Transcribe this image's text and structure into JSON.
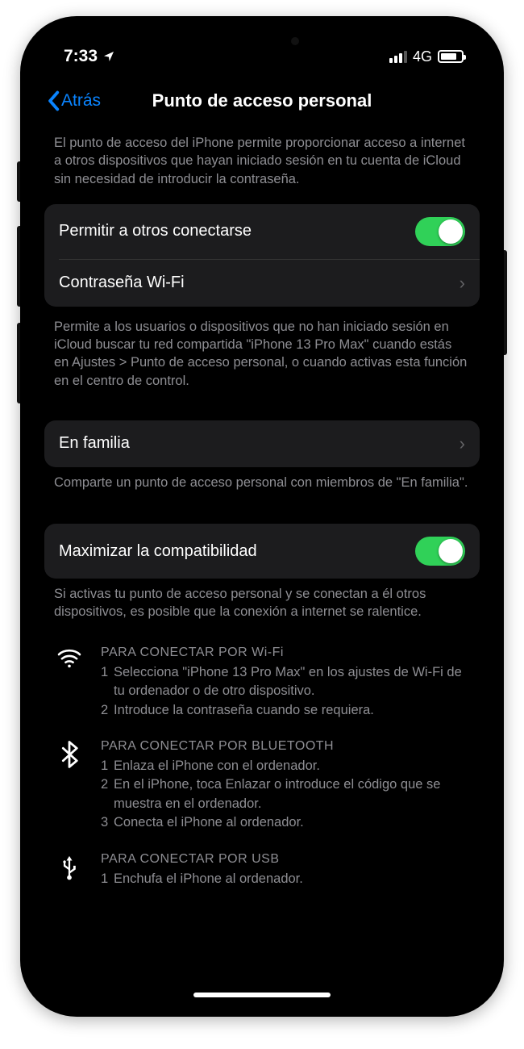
{
  "status": {
    "time": "7:33",
    "network_label": "4G"
  },
  "nav": {
    "back": "Atrás",
    "title": "Punto de acceso personal"
  },
  "desc1": "El punto de acceso del iPhone permite proporcionar acceso a internet a otros dispositivos que hayan iniciado sesión en tu cuenta de iCloud sin necesidad de introducir la contraseña.",
  "rows": {
    "allow": "Permitir a otros conectarse",
    "wifi_pwd": "Contraseña Wi-Fi",
    "family": "En familia",
    "maximize": "Maximizar la compatibilidad"
  },
  "desc2": "Permite a los usuarios o dispositivos que no han iniciado sesión en iCloud buscar tu red compartida \"iPhone 13 Pro Max\" cuando estás en Ajustes > Punto de acceso personal, o cuando activas esta función en el centro de control.",
  "desc3": "Comparte un punto de acceso personal con miembros de \"En familia\".",
  "desc4": "Si activas tu punto de acceso personal y se conectan a él otros dispositivos, es posible que la conexión a internet se ralentice.",
  "instr": {
    "wifi": {
      "title": "PARA CONECTAR POR Wi-Fi",
      "l1": "Selecciona \"iPhone 13 Pro Max\" en los ajustes de Wi-Fi de tu ordenador o de otro dispositivo.",
      "l2": "Introduce la contraseña cuando se requiera."
    },
    "bt": {
      "title": "PARA CONECTAR POR BLUETOOTH",
      "l1": "Enlaza el iPhone con el ordenador.",
      "l2": "En el iPhone, toca Enlazar o introduce el código que se muestra en el ordenador.",
      "l3": "Conecta el iPhone al ordenador."
    },
    "usb": {
      "title": "PARA CONECTAR POR USB",
      "l1": "Enchufa el iPhone al ordenador."
    }
  }
}
